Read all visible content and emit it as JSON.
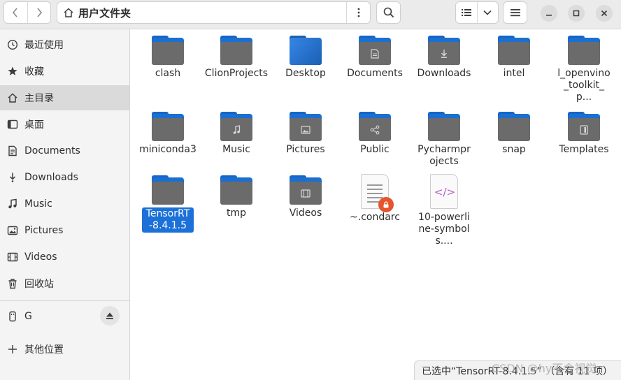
{
  "header": {
    "path_label": "用户文件夹",
    "icons": {
      "back": "chevron-left-icon",
      "forward": "chevron-right-icon",
      "home": "home-icon",
      "menu": "kebab-menu-icon",
      "search": "search-icon",
      "list_view": "list-view-icon",
      "view_options": "chevron-down-icon",
      "main_menu": "hamburger-menu-icon",
      "minimize": "minimize-icon",
      "maximize": "maximize-icon",
      "close": "close-icon"
    }
  },
  "sidebar": {
    "items": [
      {
        "label": "最近使用",
        "icon": "clock-icon"
      },
      {
        "label": "收藏",
        "icon": "star-icon"
      },
      {
        "label": "主目录",
        "icon": "home-icon",
        "active": true
      },
      {
        "label": "桌面",
        "icon": "desktop-icon"
      },
      {
        "label": "Documents",
        "icon": "document-icon"
      },
      {
        "label": "Downloads",
        "icon": "download-icon"
      },
      {
        "label": "Music",
        "icon": "music-icon"
      },
      {
        "label": "Pictures",
        "icon": "picture-icon"
      },
      {
        "label": "Videos",
        "icon": "video-icon"
      },
      {
        "label": "回收站",
        "icon": "trash-icon"
      }
    ],
    "drive": {
      "label": "G",
      "icon": "usb-drive-icon",
      "eject_icon": "eject-icon"
    },
    "other": {
      "label": "其他位置",
      "icon": "plus-icon"
    }
  },
  "files": [
    {
      "name": "clash",
      "kind": "folder"
    },
    {
      "name": "ClionProjects",
      "kind": "folder"
    },
    {
      "name": "Desktop",
      "kind": "folder-desktop"
    },
    {
      "name": "Documents",
      "kind": "folder",
      "emblem": "document-icon"
    },
    {
      "name": "Downloads",
      "kind": "folder",
      "emblem": "download-icon"
    },
    {
      "name": "intel",
      "kind": "folder"
    },
    {
      "name": "l_openvino_toolkit_p...",
      "kind": "folder"
    },
    {
      "name": "miniconda3",
      "kind": "folder"
    },
    {
      "name": "Music",
      "kind": "folder",
      "emblem": "music-icon"
    },
    {
      "name": "Pictures",
      "kind": "folder",
      "emblem": "picture-icon"
    },
    {
      "name": "Public",
      "kind": "folder",
      "emblem": "share-icon"
    },
    {
      "name": "Pycharmprojects",
      "kind": "folder"
    },
    {
      "name": "snap",
      "kind": "folder"
    },
    {
      "name": "Templates",
      "kind": "folder",
      "emblem": "template-icon"
    },
    {
      "name": "TensorRT-8.4.1.5",
      "kind": "folder",
      "selected": true
    },
    {
      "name": "tmp",
      "kind": "folder"
    },
    {
      "name": "Videos",
      "kind": "folder",
      "emblem": "video-icon"
    },
    {
      "name": "~.condarc",
      "kind": "text-locked"
    },
    {
      "name": "10-powerline-symbols....",
      "kind": "code"
    }
  ],
  "status": {
    "text": "已选中“TensorRT-8.4.1.5” （含有 11 项）"
  },
  "watermark": "CSDN @hy不会视觉"
}
